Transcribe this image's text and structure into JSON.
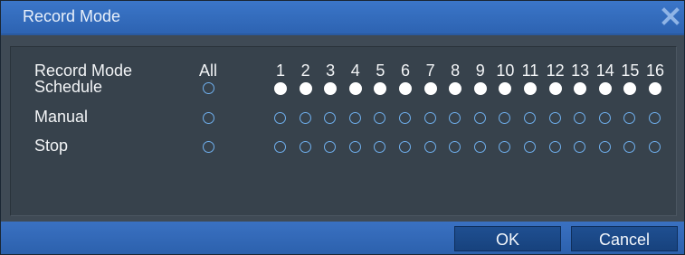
{
  "window": {
    "title": "Record Mode"
  },
  "table": {
    "header_label": "Record Mode",
    "all_label": "All",
    "channels": [
      "1",
      "2",
      "3",
      "4",
      "5",
      "6",
      "7",
      "8",
      "9",
      "10",
      "11",
      "12",
      "13",
      "14",
      "15",
      "16"
    ],
    "rows": [
      {
        "label": "Schedule",
        "all_selected": false,
        "selected": [
          true,
          true,
          true,
          true,
          true,
          true,
          true,
          true,
          true,
          true,
          true,
          true,
          true,
          true,
          true,
          true
        ]
      },
      {
        "label": "Manual",
        "all_selected": false,
        "selected": [
          false,
          false,
          false,
          false,
          false,
          false,
          false,
          false,
          false,
          false,
          false,
          false,
          false,
          false,
          false,
          false
        ]
      },
      {
        "label": "Stop",
        "all_selected": false,
        "selected": [
          false,
          false,
          false,
          false,
          false,
          false,
          false,
          false,
          false,
          false,
          false,
          false,
          false,
          false,
          false,
          false
        ]
      }
    ]
  },
  "buttons": {
    "ok_label": "OK",
    "cancel_label": "Cancel"
  },
  "colors": {
    "title_bar": "#2d63b2",
    "panel": "#37424c",
    "radio_ring": "#6fb0ee",
    "radio_selected": "#ffffff"
  }
}
